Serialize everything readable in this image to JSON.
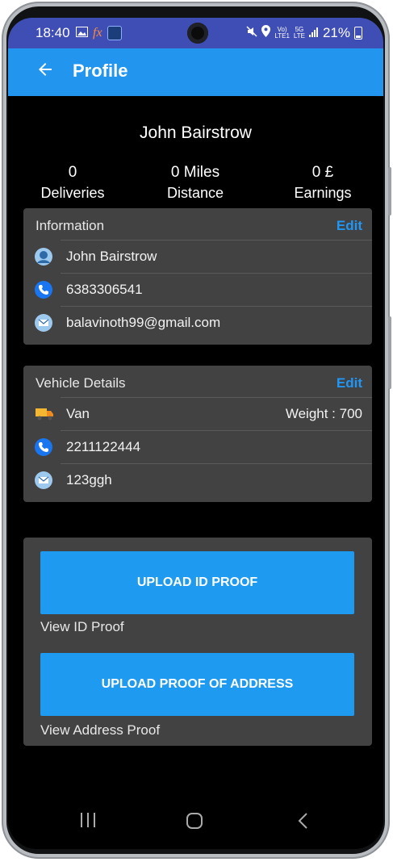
{
  "status_bar": {
    "time": "18:40",
    "network_top": "Vo)",
    "network_bottom": "LTE1",
    "network5g_top": "5G",
    "network5g_bottom": "LTE",
    "battery": "21%"
  },
  "app_bar": {
    "title": "Profile"
  },
  "profile": {
    "name": "John Bairstrow",
    "stats": [
      {
        "value": "0",
        "label": "Deliveries"
      },
      {
        "value": "0 Miles",
        "label": "Distance"
      },
      {
        "value": "0 £",
        "label": "Earnings"
      }
    ]
  },
  "information": {
    "heading": "Information",
    "edit_label": "Edit",
    "name": "John Bairstrow",
    "phone": "6383306541",
    "email": "balavinoth99@gmail.com"
  },
  "vehicle": {
    "heading": "Vehicle Details",
    "edit_label": "Edit",
    "type": "Van",
    "weight": "Weight : 700",
    "number": "2211122444",
    "registration": "123ggh"
  },
  "documents": {
    "upload_id_label": "UPLOAD ID PROOF",
    "view_id_label": "View ID Proof",
    "upload_address_label": "UPLOAD PROOF OF ADDRESS",
    "view_address_label": "View Address Proof"
  },
  "colors": {
    "accent": "#2196f3",
    "status_bar": "#3f4eb4",
    "card": "#424242",
    "background": "#000000"
  }
}
